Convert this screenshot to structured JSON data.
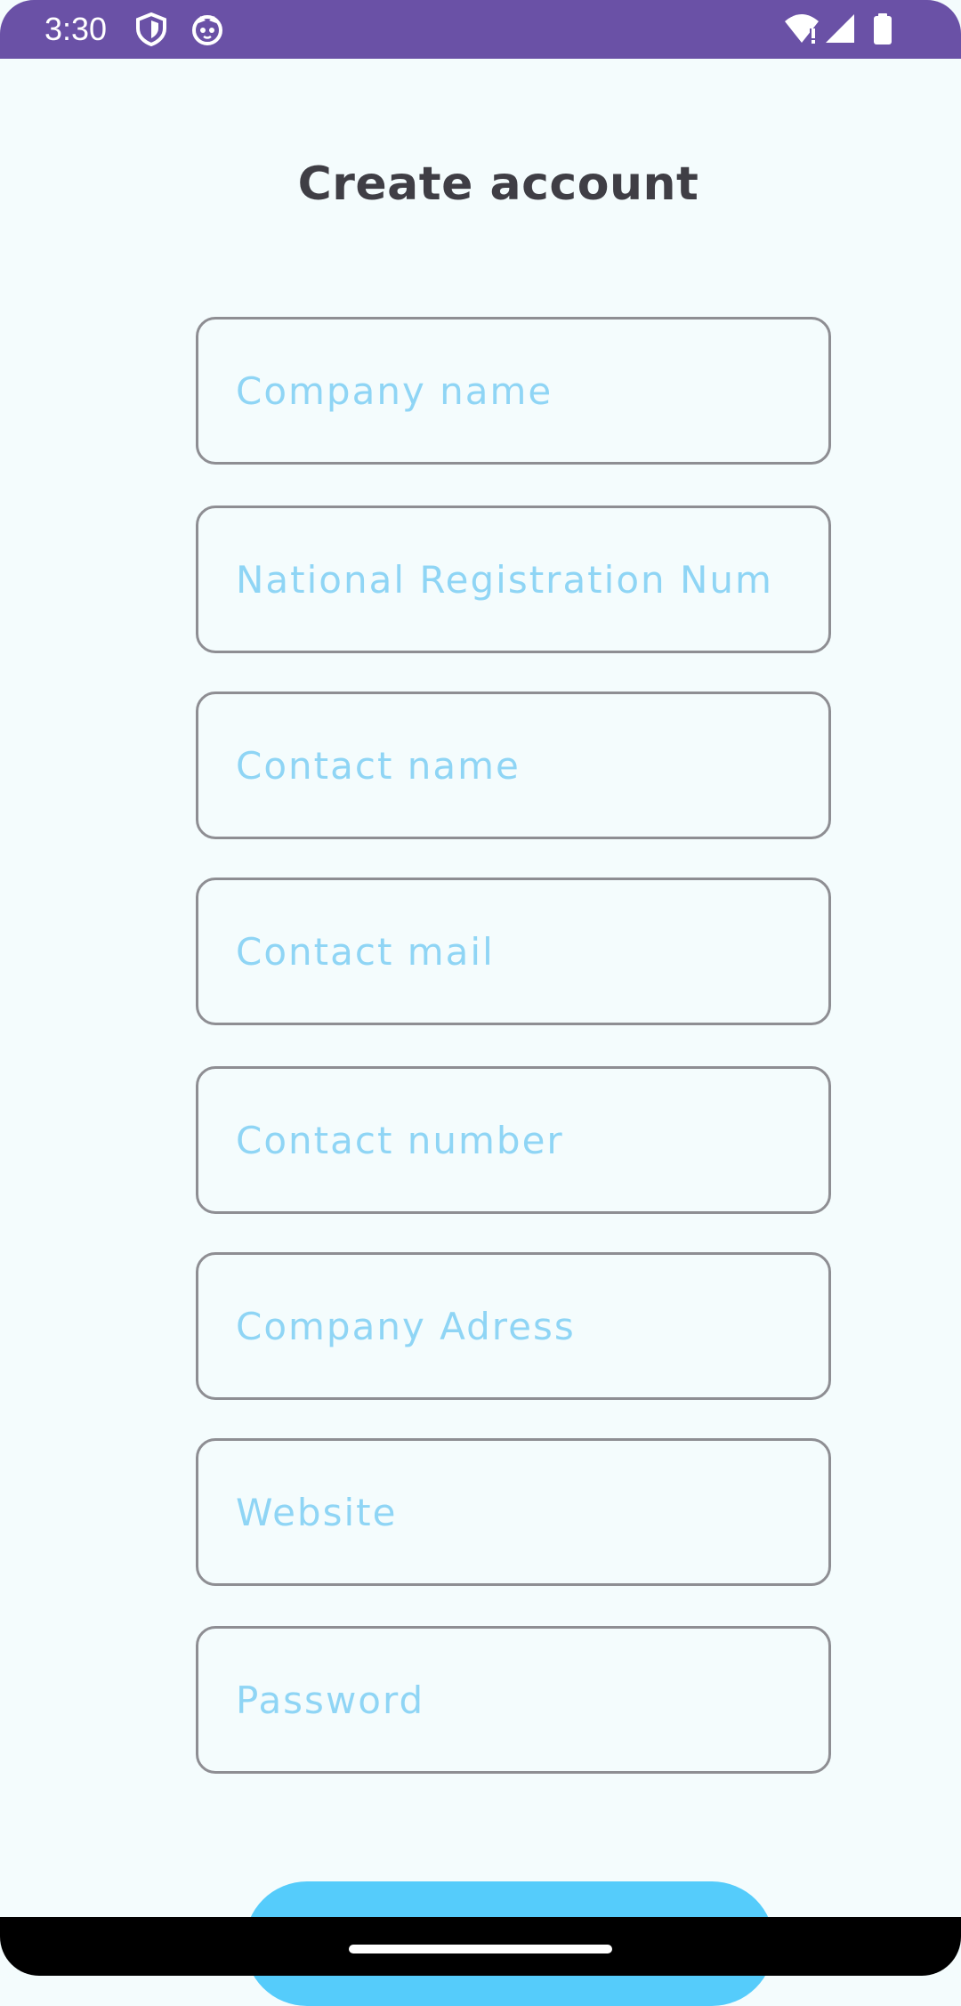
{
  "status_bar": {
    "time": "3:30",
    "icons": [
      "shield-icon",
      "cat-face-icon",
      "wifi-alert-icon",
      "signal-icon",
      "battery-icon"
    ],
    "background": "#6a51a6"
  },
  "page": {
    "title": "Create account",
    "title_color": "#3f3e45",
    "background": "#f4fcfd"
  },
  "form": {
    "fields": [
      {
        "placeholder": "Company name",
        "value": ""
      },
      {
        "placeholder": "National Registration Num",
        "value": ""
      },
      {
        "placeholder": "Contact name",
        "value": ""
      },
      {
        "placeholder": "Contact mail",
        "value": ""
      },
      {
        "placeholder": "Contact number",
        "value": ""
      },
      {
        "placeholder": "Company Adress",
        "value": ""
      },
      {
        "placeholder": "Website",
        "value": ""
      },
      {
        "placeholder": "Password",
        "value": ""
      }
    ],
    "placeholder_color": "#8fd5f5",
    "submit": {
      "label": "",
      "color": "#55ccfb"
    }
  },
  "nav_bar": {
    "icons": [
      "home-indicator"
    ],
    "background": "#000000"
  }
}
